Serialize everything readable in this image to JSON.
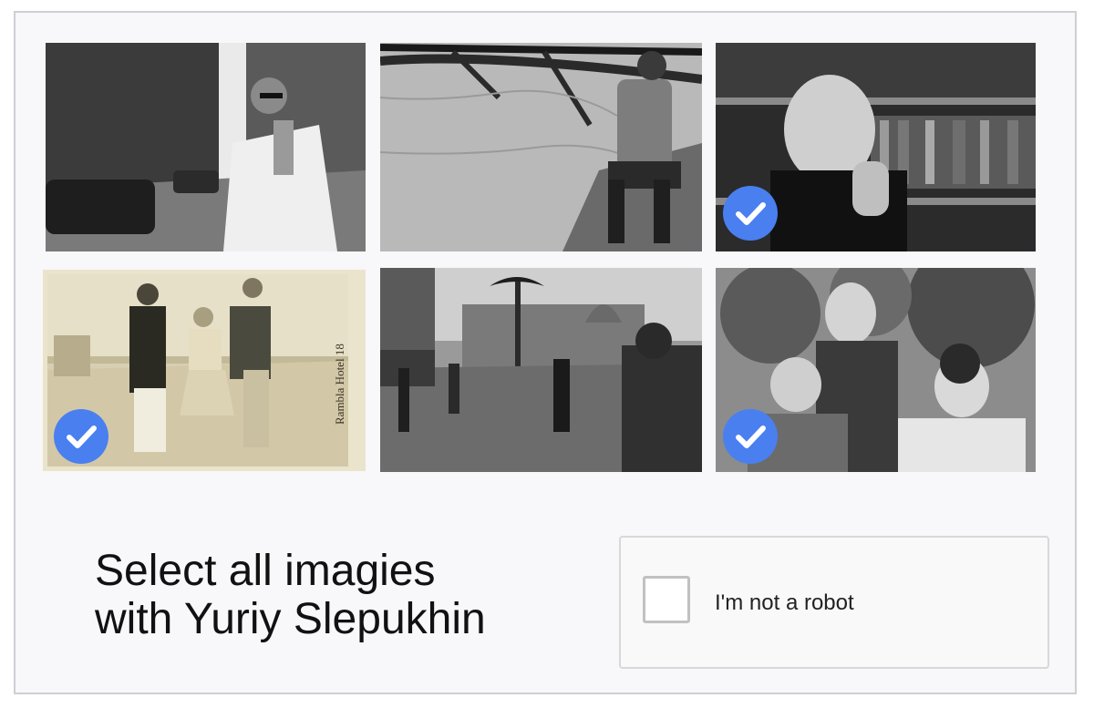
{
  "prompt": {
    "line1": "Select all imagies",
    "line2": "with Yuriy Slepukhin"
  },
  "recaptcha": {
    "label": "I'm not a robot",
    "checked": false
  },
  "tiles": [
    {
      "id": 1,
      "selected": false
    },
    {
      "id": 2,
      "selected": false
    },
    {
      "id": 3,
      "selected": true
    },
    {
      "id": 4,
      "selected": true
    },
    {
      "id": 5,
      "selected": false
    },
    {
      "id": 6,
      "selected": true
    }
  ],
  "photo_stamp_text": "Rambla Hotel 18",
  "colors": {
    "check_blue": "#4a7ff0",
    "frame_border": "#cfcfd4",
    "background": "#f8f7fa"
  }
}
